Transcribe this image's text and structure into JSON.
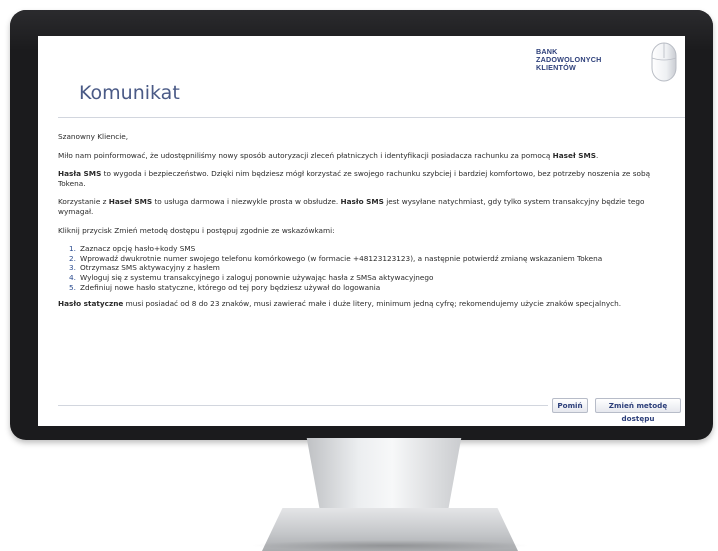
{
  "bank": {
    "logo_lines": [
      "BANK",
      "ZADOWOLONYCH",
      "KLIENTÓW"
    ],
    "accent_color": "#2d3f7a"
  },
  "page": {
    "title": "Komunikat"
  },
  "message": {
    "greeting": "Szanowny Kliencie,",
    "p1_text": "Miło nam poinformować, że udostępniliśmy nowy sposób autoryzacji zleceń płatniczych i identyfikacji posiadacza rachunku za pomocą ",
    "p1_bold": "Haseł SMS",
    "p1_end": ".",
    "p2_bold": "Hasła SMS",
    "p2_text": " to wygoda i bezpieczeństwo. Dzięki nim będziesz mógł korzystać ze swojego rachunku szybciej i bardziej komfortowo, bez potrzeby noszenia ze sobą Tokena.",
    "p3_text_a": "Korzystanie z ",
    "p3_bold_a": "Haseł SMS",
    "p3_text_b": " to usługa darmowa i niezwykle prosta w obsłudze. ",
    "p3_bold_b": "Hasło SMS",
    "p3_text_c": " jest wysyłane natychmiast, gdy tylko system transakcyjny będzie tego wymagał.",
    "p4_text": "Kliknij przycisk Zmień metodę dostępu i postępuj zgodnie ze wskazówkami:",
    "steps": [
      {
        "num": "1.",
        "text": "Zaznacz opcję hasło+kody SMS"
      },
      {
        "num": "2.",
        "text": "Wprowadź dwukrotnie numer swojego telefonu komórkowego (w formacie +48123123123), a następnie potwierdź zmianę wskazaniem Tokena"
      },
      {
        "num": "3.",
        "text": "Otrzymasz SMS aktywacyjny z hasłem"
      },
      {
        "num": "4.",
        "text": "Wyloguj się z systemu transakcyjnego i zaloguj ponownie używając hasła z SMSa aktywacyjnego"
      },
      {
        "num": "5.",
        "text": "Zdefiniuj nowe hasło statyczne, którego od tej pory będziesz używał do logowania"
      }
    ],
    "p5_bold": "Hasło statyczne",
    "p5_text": " musi posiadać od 8 do 23 znaków, musi zawierać małe i duże litery, minimum jedną cyfrę; rekomendujemy użycie znaków specjalnych."
  },
  "actions": {
    "skip_label": "Pomiń",
    "change_label": "Zmień metodę dostępu"
  }
}
